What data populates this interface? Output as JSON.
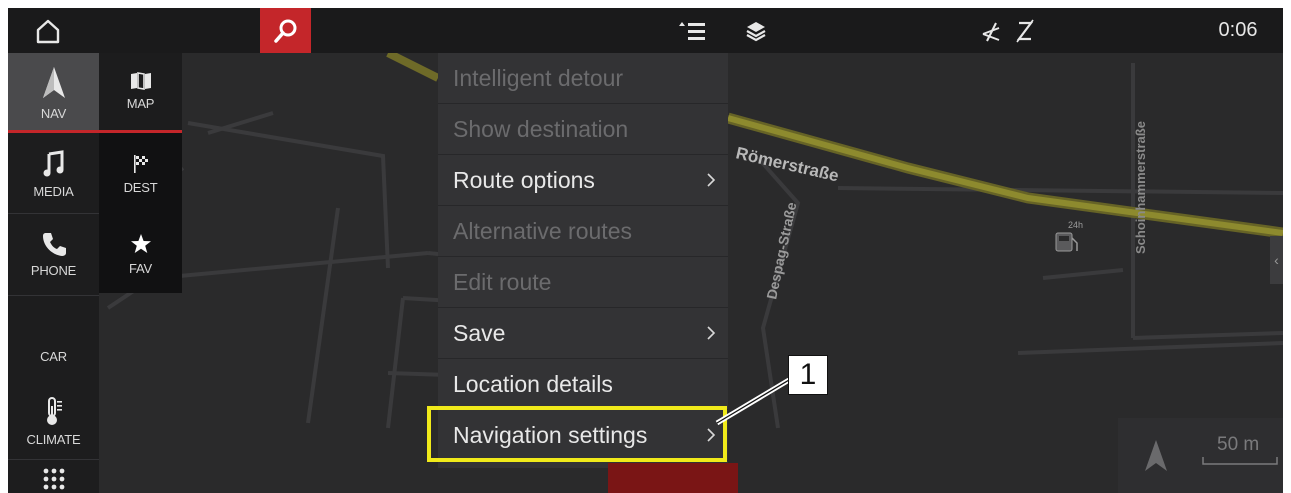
{
  "topbar": {
    "home_icon": "home-icon",
    "search_icon": "search-icon",
    "menu_icon": "menu-list-icon",
    "layers_icon": "layers-icon",
    "mute_icon": "mute-icon",
    "pen_icon": "pen-off-icon",
    "clock": "0:06",
    "search_color": "#c4262a"
  },
  "sidebar": {
    "primary": [
      {
        "icon": "navigation-arrow-icon",
        "label": "NAV"
      },
      {
        "icon": "music-note-icon",
        "label": "MEDIA"
      },
      {
        "icon": "phone-icon",
        "label": "PHONE"
      },
      {
        "icon": "",
        "label": "CAR"
      },
      {
        "icon": "thermometer-icon",
        "label": "CLIMATE"
      },
      {
        "icon": "apps-grid-icon",
        "label": ""
      }
    ],
    "secondary": [
      {
        "icon": "map-book-icon",
        "label": "MAP"
      },
      {
        "icon": "checkered-flag-icon",
        "label": "DEST"
      },
      {
        "icon": "star-icon",
        "label": "FAV"
      }
    ]
  },
  "map": {
    "streets": [
      "Römerstraße",
      "Despag-Straße",
      "Schoinhammerstraße"
    ],
    "poi": "24h",
    "scale_label": "50 m"
  },
  "menu": {
    "items": [
      {
        "label": "Intelligent detour",
        "enabled": false,
        "has_submenu": false
      },
      {
        "label": "Show destination",
        "enabled": false,
        "has_submenu": false
      },
      {
        "label": "Route options",
        "enabled": true,
        "has_submenu": true
      },
      {
        "label": "Alternative routes",
        "enabled": false,
        "has_submenu": false
      },
      {
        "label": "Edit route",
        "enabled": false,
        "has_submenu": false
      },
      {
        "label": "Save",
        "enabled": true,
        "has_submenu": true
      },
      {
        "label": "Location details",
        "enabled": true,
        "has_submenu": false
      },
      {
        "label": "Navigation settings",
        "enabled": true,
        "has_submenu": true
      }
    ]
  },
  "callout": {
    "number": "1",
    "highlight_color": "#f0ea1a"
  }
}
